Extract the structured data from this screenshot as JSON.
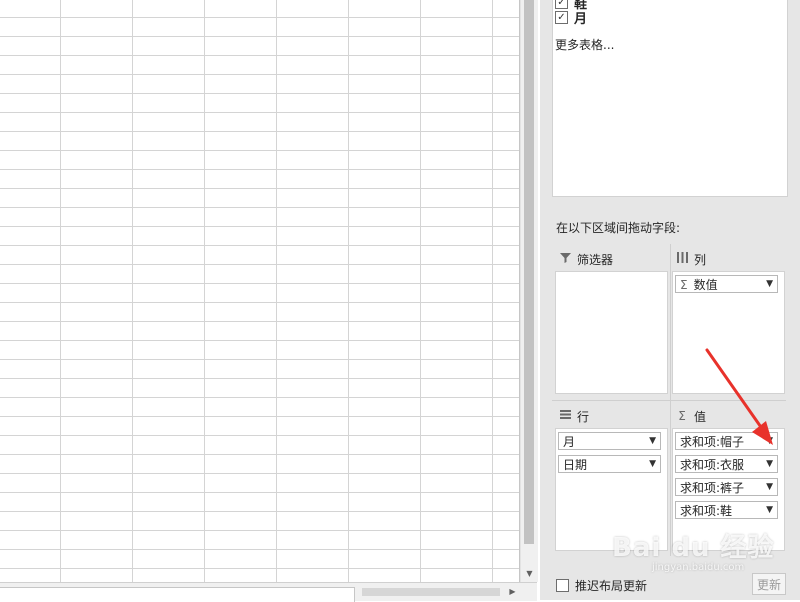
{
  "pane": {
    "fields": [
      {
        "label": "鞋",
        "checked": true
      },
      {
        "label": "月",
        "checked": true
      }
    ],
    "more_tables": "更多表格...",
    "drag_hint": "在以下区域间拖动字段:",
    "areas": {
      "filters": {
        "title": "筛选器",
        "icon": "filter-icon",
        "items": []
      },
      "columns": {
        "title": "列",
        "icon": "columns-icon",
        "items": [
          {
            "label": "数值",
            "sigma": "Σ"
          }
        ]
      },
      "rows": {
        "title": "行",
        "icon": "rows-icon",
        "items": [
          {
            "label": "月"
          },
          {
            "label": "日期"
          }
        ]
      },
      "values": {
        "title": "值",
        "icon": "sigma-icon",
        "items": [
          {
            "label": "求和项:帽子"
          },
          {
            "label": "求和项:衣服"
          },
          {
            "label": "求和项:裤子"
          },
          {
            "label": "求和项:鞋"
          }
        ]
      }
    },
    "defer_label": "推迟布局更新",
    "update_label": "更新"
  },
  "watermark": {
    "main": "Bai du 经验",
    "sub": "jingyan.baidu.com"
  },
  "colors": {
    "annotation_arrow": "#e8322b",
    "pane_bg": "#e6e6e6",
    "grid": "#d4d4d4"
  }
}
